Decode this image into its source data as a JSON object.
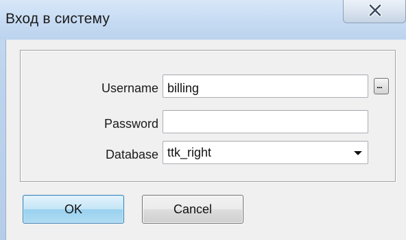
{
  "window": {
    "title": "Вход в систему",
    "close_icon": "close-x-icon"
  },
  "form": {
    "username_label": "Username",
    "username_value": "billing",
    "browse_label": "...",
    "password_label": "Password",
    "password_value": "",
    "database_label": "Database",
    "database_selected": "ttk_right"
  },
  "buttons": {
    "ok_label": "OK",
    "cancel_label": "Cancel"
  },
  "colors": {
    "frame": "#bcd3ee",
    "client_background": "#f0f0f0",
    "default_button_border": "#3c7fb1"
  }
}
